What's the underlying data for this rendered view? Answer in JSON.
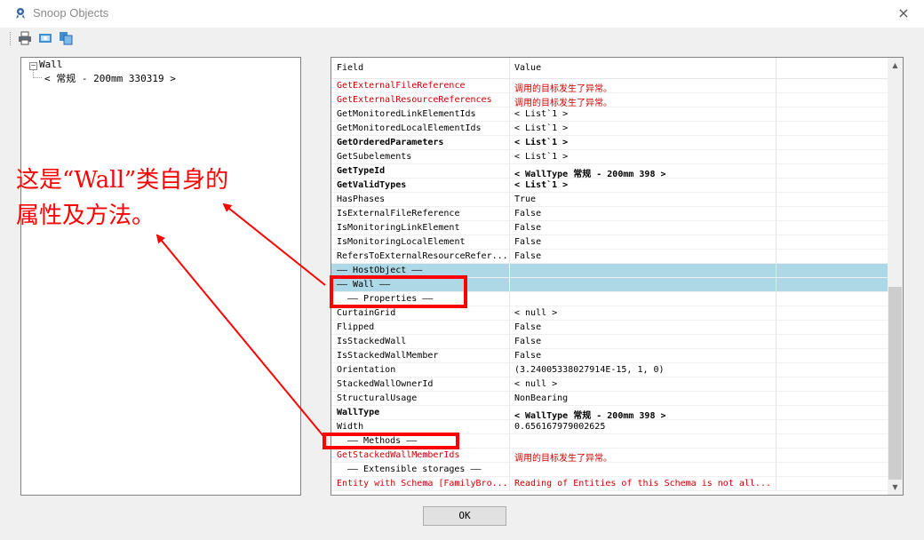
{
  "window": {
    "title": "Snoop Objects",
    "close_icon": "×"
  },
  "toolbar": {
    "buttons": [
      {
        "name": "print-icon"
      },
      {
        "name": "preview-icon"
      },
      {
        "name": "copy-icon"
      }
    ]
  },
  "tree": {
    "root": {
      "label": "Wall",
      "toggle": "−"
    },
    "child": {
      "label": "< 常规 - 200mm  330319 >"
    }
  },
  "grid": {
    "headers": {
      "field": "Field",
      "value": "Value"
    },
    "rows": [
      {
        "field": "GetExternalFileReference",
        "value": "调用的目标发生了异常。",
        "style": "red"
      },
      {
        "field": "GetExternalResourceReferences",
        "value": "调用的目标发生了异常。",
        "style": "red"
      },
      {
        "field": "GetMonitoredLinkElementIds",
        "value": "< List`1 >",
        "style": "normal"
      },
      {
        "field": "GetMonitoredLocalElementIds",
        "value": "< List`1 >",
        "style": "normal"
      },
      {
        "field": "GetOrderedParameters",
        "value": "< List`1 >",
        "style": "bold"
      },
      {
        "field": "GetSubelements",
        "value": "< List`1 >",
        "style": "normal"
      },
      {
        "field": "GetTypeId",
        "value": "< WallType  常规 - 200mm   398 >",
        "style": "bold"
      },
      {
        "field": "GetValidTypes",
        "value": "< List`1 >",
        "style": "bold"
      },
      {
        "field": "HasPhases",
        "value": "True",
        "style": "normal"
      },
      {
        "field": "IsExternalFileReference",
        "value": "False",
        "style": "normal"
      },
      {
        "field": "IsMonitoringLinkElement",
        "value": "False",
        "style": "normal"
      },
      {
        "field": "IsMonitoringLocalElement",
        "value": "False",
        "style": "normal"
      },
      {
        "field": "RefersToExternalResourceRefer...",
        "value": "False",
        "style": "normal"
      },
      {
        "field": "—— HostObject ——",
        "value": "",
        "style": "section-hl"
      },
      {
        "field": "—— Wall ——",
        "value": "",
        "style": "section-hl"
      },
      {
        "field": "—— Properties ——",
        "value": "",
        "style": "section-indent"
      },
      {
        "field": "CurtainGrid",
        "value": "< null >",
        "style": "normal"
      },
      {
        "field": "Flipped",
        "value": "False",
        "style": "normal"
      },
      {
        "field": "IsStackedWall",
        "value": "False",
        "style": "normal"
      },
      {
        "field": "IsStackedWallMember",
        "value": "False",
        "style": "normal"
      },
      {
        "field": "Orientation",
        "value": "(3.24005338027914E-15, 1, 0)",
        "style": "normal"
      },
      {
        "field": "StackedWallOwnerId",
        "value": "< null >",
        "style": "normal"
      },
      {
        "field": "StructuralUsage",
        "value": "NonBearing",
        "style": "normal"
      },
      {
        "field": "WallType",
        "value": "< WallType  常规 - 200mm   398 >",
        "style": "bold"
      },
      {
        "field": "Width",
        "value": "0.656167979002625",
        "style": "normal"
      },
      {
        "field": "—— Methods ——",
        "value": "",
        "style": "section-indent"
      },
      {
        "field": "GetStackedWallMemberIds",
        "value": "调用的目标发生了异常。",
        "style": "red"
      },
      {
        "field": "—— Extensible storages ——",
        "value": "",
        "style": "section-indent"
      },
      {
        "field": "Entity with Schema [FamilyBro...",
        "value": "Reading of Entities of this Schema is not all...",
        "style": "red"
      }
    ],
    "scroll_up": "▲",
    "scroll_down": "▼"
  },
  "ok_button": {
    "label": "OK"
  },
  "annotation": {
    "line1": "这是“Wall”类自身的",
    "line2": "属性及方法。",
    "color": "#ff0000"
  }
}
